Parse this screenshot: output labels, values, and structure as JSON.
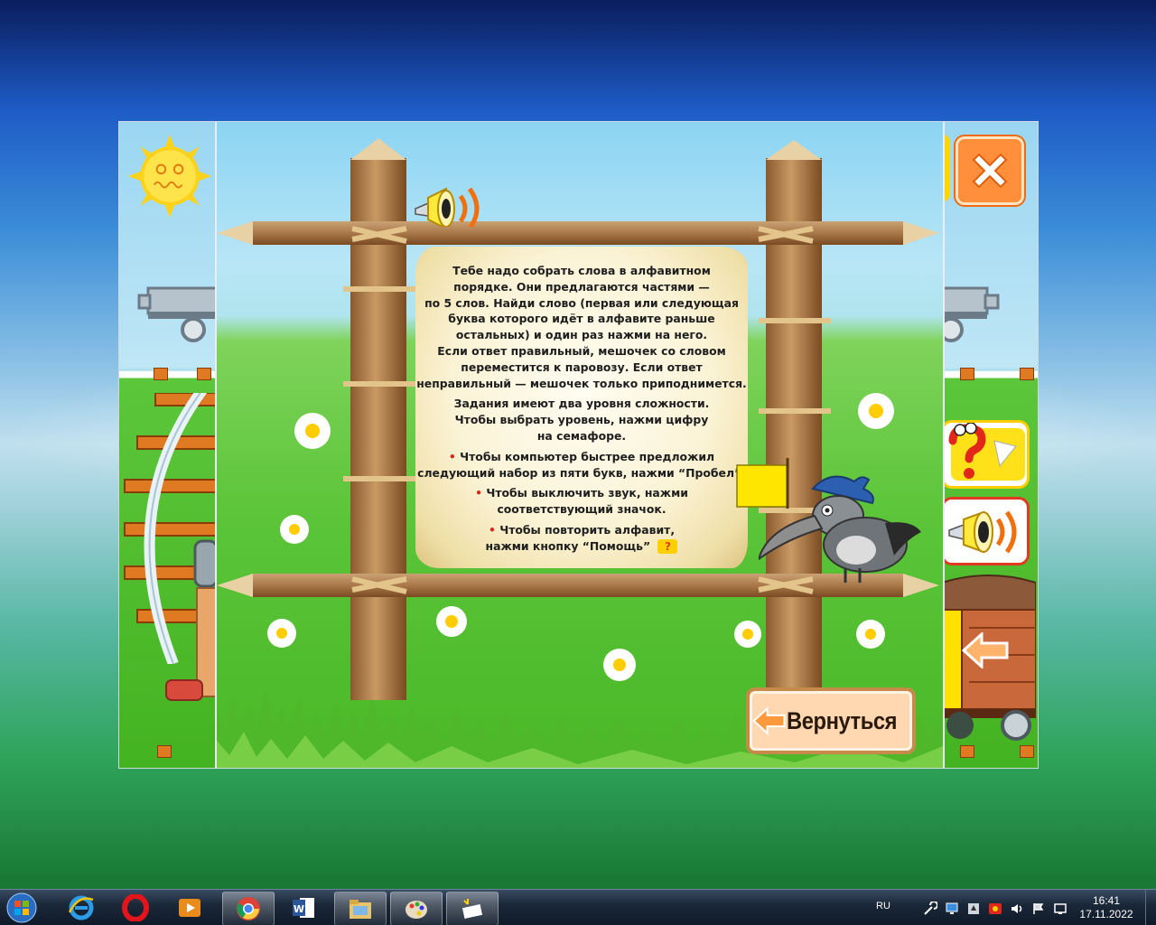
{
  "instructions": {
    "para1": [
      "Тебе надо собрать слова в алфавитном",
      "порядке. Они предлагаются частями —",
      "по 5 слов. Найди слово (первая или следующая",
      "буква которого идёт в алфавите раньше",
      "остальных) и один раз нажми на него.",
      "Если ответ правильный, мешочек со словом",
      "переместится к паровозу. Если ответ",
      "неправильный — мешочек только приподнимется."
    ],
    "para2": [
      "Задания имеют два уровня сложности.",
      "Чтобы выбрать уровень, нажми цифру",
      "на семафоре."
    ],
    "bullet1": [
      "Чтобы компьютер быстрее предложил",
      "следующий набор из пяти букв, нажми “Пробел”."
    ],
    "bullet2": [
      "Чтобы выключить звук, нажми",
      "соответствующий значок."
    ],
    "bullet3": [
      "Чтобы повторить алфавит,",
      "нажми кнопку “Помощь”"
    ]
  },
  "buttons": {
    "return_label": "Вернуться"
  },
  "taskbar": {
    "language": "RU",
    "time": "16:41",
    "date": "17.11.2022",
    "apps": [
      "internet-explorer",
      "opera",
      "media-player",
      "chrome",
      "word",
      "file-manager",
      "paint",
      "alphabet-game"
    ]
  },
  "colors": {
    "sky": "#8bd4f3",
    "grass": "#5cc53a",
    "wood": "#b98a55",
    "close": "#ff8f3a",
    "return_bg": "#ffd7b0"
  }
}
